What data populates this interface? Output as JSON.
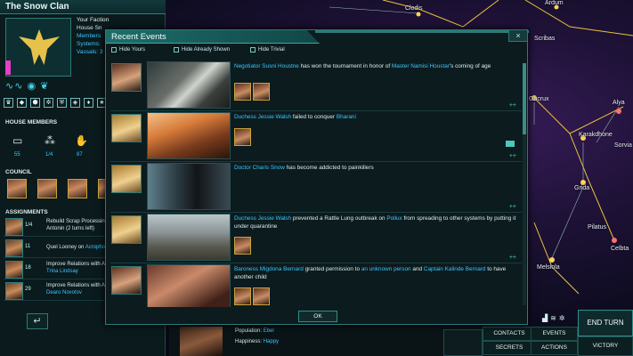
{
  "clan": {
    "title": "The Snow Clan"
  },
  "faction": {
    "header": "Your Faction",
    "line1": "House Sn",
    "line2": "Members",
    "line3": "Systems:",
    "line4": "Vassals: 3"
  },
  "left_panel": {
    "house_members_title": "HOUSE MEMBERS",
    "house_member_counts": [
      "55",
      "1/4",
      "87"
    ],
    "council_title": "COUNCIL",
    "assignments_title": "ASSIGNMENTS",
    "assignments": [
      {
        "count": "1/4",
        "text_a": "Rebuild Scrap Processing",
        "text_b": "Antonin (2 turns left)"
      },
      {
        "count": "11",
        "text_a": "Quel Looney on",
        "highlight": "Acrophos"
      },
      {
        "count": "18",
        "text_a": "Improve Relations with A",
        "text_b": "Trina Lindsay"
      },
      {
        "count": "29",
        "text_a": "Improve Relations with A",
        "text_b": "Dearo Novotov"
      }
    ]
  },
  "starmap": {
    "systems": [
      "Ardum",
      "Clodis",
      "Scribas",
      "Gacrux",
      "Alya",
      "Karakdhone",
      "Sorvia",
      "Grida",
      "Pilatus",
      "Melsiola",
      "Celbta"
    ]
  },
  "dialog": {
    "title": "Recent Events",
    "filters": [
      "Hide Yours",
      "Hide Already Shown",
      "Hide Trivial"
    ],
    "ok": "OK",
    "events": [
      {
        "parts": [
          {
            "t": "Negotiator Susni Houstne",
            "hl": true
          },
          {
            "t": " has won the tournament in honor of ",
            "hl": false
          },
          {
            "t": "Master Namisi Houstar",
            "hl": true
          },
          {
            "t": "'s coming of age",
            "hl": false
          }
        ]
      },
      {
        "parts": [
          {
            "t": "Duchess Jessie Walsh",
            "hl": true
          },
          {
            "t": " failed to conquer ",
            "hl": false
          },
          {
            "t": "Bharani",
            "hl": true
          }
        ]
      },
      {
        "parts": [
          {
            "t": "Doctor Charis Snow",
            "hl": true
          },
          {
            "t": " has become addicted to painkillers",
            "hl": false
          }
        ]
      },
      {
        "parts": [
          {
            "t": "Duchess Jessie Walsh",
            "hl": true
          },
          {
            "t": " prevented a Rattle Lung outbreak on ",
            "hl": false
          },
          {
            "t": "Pollux",
            "hl": true
          },
          {
            "t": " from spreading to other systems by putting it under quarantine",
            "hl": false
          }
        ]
      },
      {
        "parts": [
          {
            "t": "Baroness Migdona Bernard",
            "hl": true
          },
          {
            "t": " granted permission to ",
            "hl": false
          },
          {
            "t": "an unknown person",
            "hl": true
          },
          {
            "t": " and ",
            "hl": false
          },
          {
            "t": "Captain Kalinde Bernard",
            "hl": true
          },
          {
            "t": " to have another child",
            "hl": false
          }
        ]
      }
    ]
  },
  "bottom": {
    "population_label": "Population:",
    "population_value": "Ebel",
    "happiness_label": "Happiness:",
    "happiness_value": "Happy",
    "buttons": {
      "contacts": "CONTACTS",
      "events": "EVENTS",
      "secrets": "SECRETS",
      "actions": "ACTIONS",
      "end_turn": "END TURN",
      "victory": "VICTORY"
    }
  },
  "colors": {
    "accent": "#2c7a77",
    "highlight": "#38c6ff",
    "gold": "#c9a23b",
    "panel": "#0c1b1e"
  }
}
